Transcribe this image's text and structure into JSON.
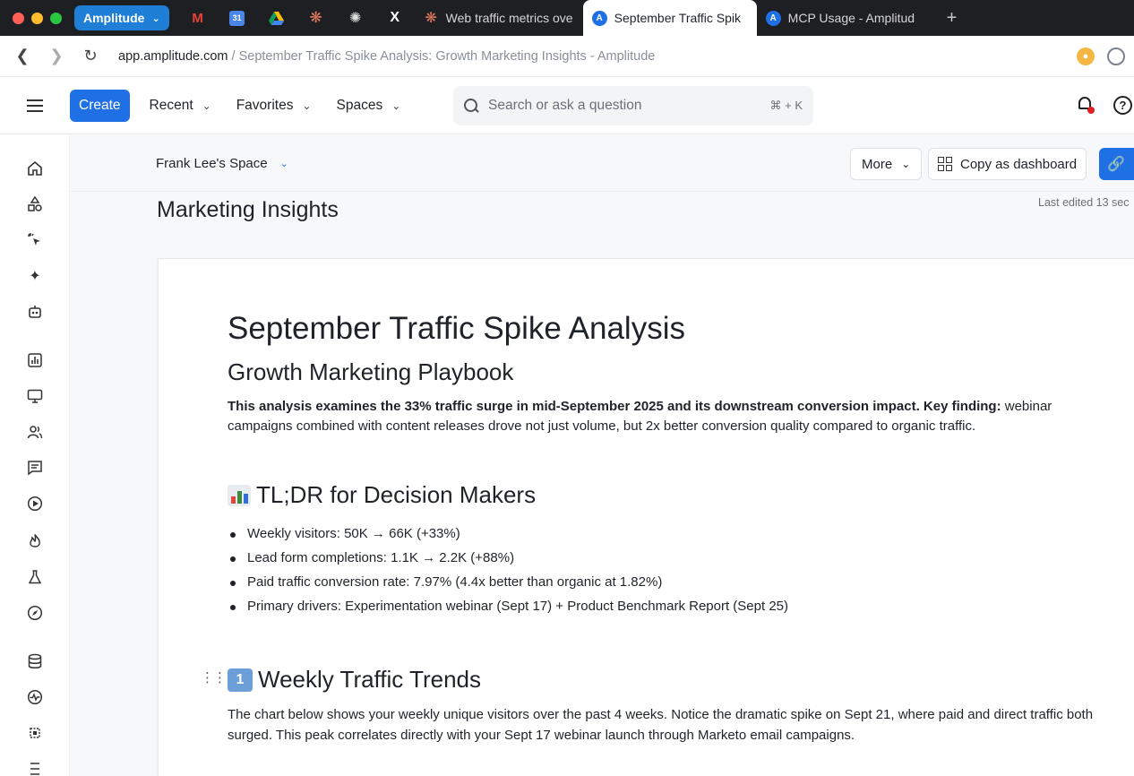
{
  "browser": {
    "tab_group_label": "Amplitude",
    "tabs": [
      {
        "label": "Web traffic metrics ove",
        "active": false
      },
      {
        "label": "September Traffic Spik",
        "active": true
      },
      {
        "label": "MCP Usage - Amplitud",
        "active": false
      }
    ],
    "url_host": "app.amplitude.com",
    "url_path": " / September Traffic Spike Analysis: Growth Marketing Insights - Amplitude"
  },
  "appnav": {
    "create_label": "Create",
    "menus": [
      "Recent",
      "Favorites",
      "Spaces"
    ],
    "search_placeholder": "Search or ask a question",
    "search_shortcut": "⌘ + K"
  },
  "space": {
    "name": "Frank Lee's Space",
    "more_label": "More",
    "copy_label": "Copy as dashboard"
  },
  "notebook": {
    "title": "Marketing Insights",
    "last_edited": "Last edited 13 sec"
  },
  "document": {
    "title": "September Traffic Spike Analysis",
    "subtitle": "Growth Marketing Playbook",
    "intro_bold": "This analysis examines the 33% traffic surge in mid-September 2025 and its downstream conversion impact. Key finding:",
    "intro_rest": " webinar campaigns combined with content releases drove not just volume, but 2x better conversion quality compared to organic traffic.",
    "tldr_heading": "TL;DR for Decision Makers",
    "tldr_items": [
      "Weekly visitors: 50K → 66K (+33%)",
      "Lead form completions: 1.1K → 2.2K (+88%)",
      "Paid traffic conversion rate: 7.97% (4.4x better than organic at 1.82%)",
      "Primary drivers: Experimentation webinar (Sept 17) + Product Benchmark Report (Sept 25)"
    ],
    "section1_number": "1",
    "section1_heading": "Weekly Traffic Trends",
    "section1_text": "The chart below shows your weekly unique visitors over the past 4 weeks. Notice the dramatic spike on Sept 21, where paid and direct traffic both surged. This peak correlates directly with your Sept 17 webinar launch through Marketo email campaigns."
  }
}
